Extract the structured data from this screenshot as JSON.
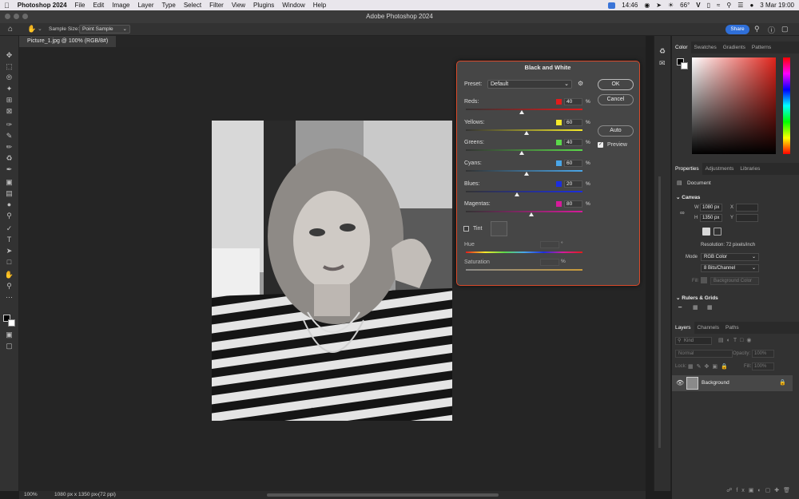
{
  "menubar": {
    "app_name": "Photoshop 2024",
    "items": [
      "File",
      "Edit",
      "Image",
      "Layer",
      "Type",
      "Select",
      "Filter",
      "View",
      "Plugins",
      "Window",
      "Help"
    ],
    "clock": "14:46",
    "temperature": "66°",
    "date_time": "3 Mar  19:00"
  },
  "titlebar": {
    "title": "Adobe Photoshop 2024"
  },
  "optionsbar": {
    "sample_size_label": "Sample Size:",
    "sample_size_value": "Point Sample",
    "share_label": "Share"
  },
  "document": {
    "tab_title": "Picture_1.jpg @ 100% (RGB/8#)"
  },
  "status": {
    "zoom": "100%",
    "info": "1080 px x 1350 px (72 ppi)"
  },
  "dialog": {
    "title": "Black and White",
    "preset_label": "Preset:",
    "preset_value": "Default",
    "ok_label": "OK",
    "cancel_label": "Cancel",
    "auto_label": "Auto",
    "preview_label": "Preview",
    "preview_checked": true,
    "tint_label": "Tint",
    "hue_label": "Hue",
    "hue_unit": "°",
    "saturation_label": "Saturation",
    "saturation_unit": "%",
    "sliders": [
      {
        "label": "Reds:",
        "value": "40",
        "unit": "%",
        "color": "#e21b1b"
      },
      {
        "label": "Yellows:",
        "value": "60",
        "unit": "%",
        "color": "#f5ea2a"
      },
      {
        "label": "Greens:",
        "value": "40",
        "unit": "%",
        "color": "#5bd84a"
      },
      {
        "label": "Cyans:",
        "value": "60",
        "unit": "%",
        "color": "#4aa6e8"
      },
      {
        "label": "Blues:",
        "value": "20",
        "unit": "%",
        "color": "#1b2ee0"
      },
      {
        "label": "Magentas:",
        "value": "80",
        "unit": "%",
        "color": "#d61b9a"
      }
    ]
  },
  "color_panel": {
    "tabs": [
      "Color",
      "Swatches",
      "Gradients",
      "Patterns"
    ],
    "accent": "#e0241b"
  },
  "properties_panel": {
    "tabs": [
      "Properties",
      "Adjustments",
      "Libraries"
    ],
    "document_label": "Document",
    "canvas_label": "Canvas",
    "w_label": "W",
    "w_value": "1080 px",
    "h_label": "H",
    "h_value": "1350 px",
    "x_label": "X",
    "y_label": "Y",
    "resolution": "Resolution: 72 pixels/inch",
    "mode_label": "Mode",
    "mode_value": "RGB Color",
    "bits_value": "8 Bits/Channel",
    "fill_label": "Fill",
    "fill_value": "Background Color",
    "rulers_label": "Rulers & Grids"
  },
  "layers_panel": {
    "tabs": [
      "Layers",
      "Channels",
      "Paths"
    ],
    "kind_placeholder": "Kind",
    "blend_mode": "Normal",
    "opacity_label": "Opacity:",
    "opacity_value": "100%",
    "lock_label": "Lock:",
    "fill_label": "Fill:",
    "fill_value": "100%",
    "layer_name": "Background"
  }
}
